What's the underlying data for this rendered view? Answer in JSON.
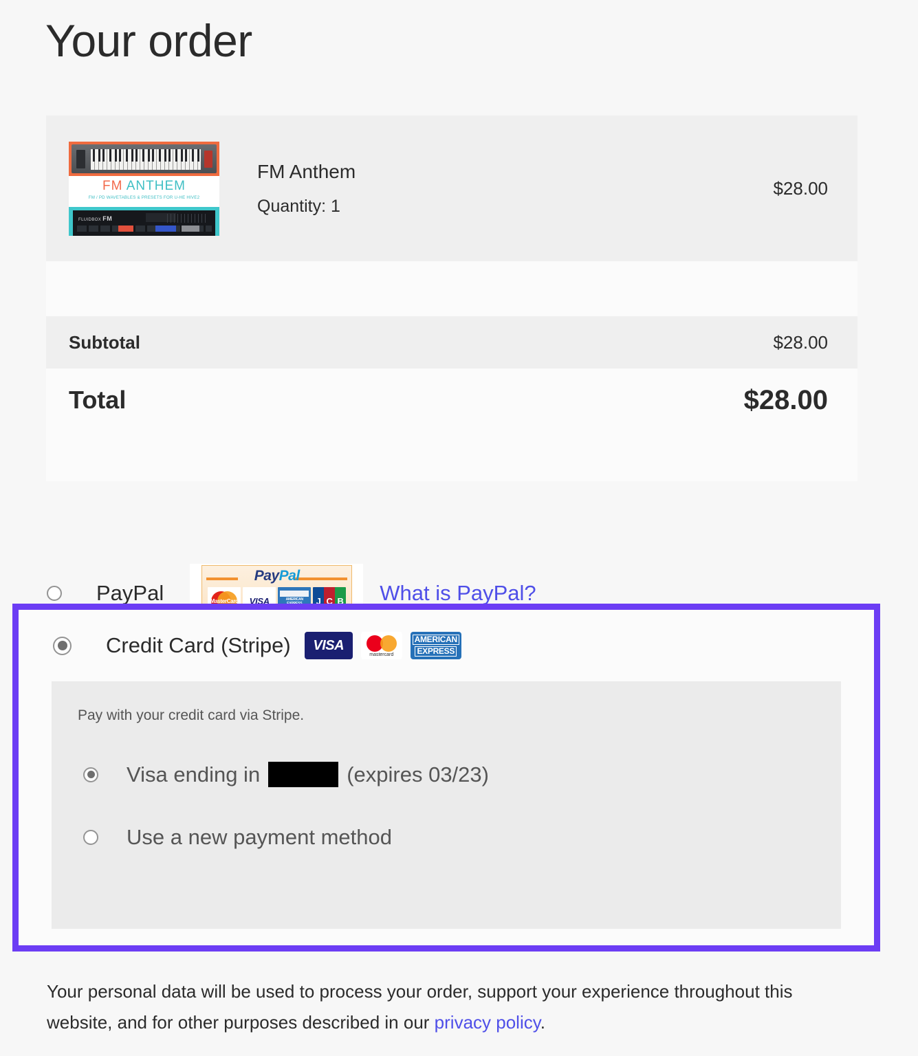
{
  "page": {
    "title": "Your order"
  },
  "order": {
    "product": {
      "name": "FM Anthem",
      "quantity_label": "Quantity: 1",
      "price": "$28.00",
      "thumbnail": {
        "title_part1": "FM ",
        "title_part2": "ANTHEM",
        "subtitle": "FM / PD WAVETABLES & PRESETS FOR U-HE HIVE2",
        "synth_logo_brand": "FLUIDBOX",
        "synth_logo_name": "FM"
      }
    },
    "subtotal_label": "Subtotal",
    "subtotal_value": "$28.00",
    "total_label": "Total",
    "total_value": "$28.00"
  },
  "payment": {
    "paypal": {
      "label": "PayPal",
      "link_label": "What is PayPal?",
      "badge": {
        "wordmark_pay": "Pay",
        "wordmark_pal": "Pal",
        "cards": [
          "MasterCard",
          "VISA",
          "AMERICAN EXPRESS",
          "JCB"
        ],
        "mastercard_text": "MasterCard",
        "visa_text": "VISA",
        "amex_text": "AMERICAN EXPRESS",
        "jcb_j": "J",
        "jcb_c": "C",
        "jcb_b": "B"
      }
    },
    "stripe": {
      "label": "Credit Card (Stripe)",
      "description": "Pay with your credit card via Stripe.",
      "brands": {
        "visa_text": "VISA",
        "mastercard_text": "mastercard",
        "amex_line1": "AMERICAN",
        "amex_line2": "EXPRESS"
      },
      "saved_card": {
        "prefix": "Visa ending in",
        "digits_redacted": "",
        "suffix": "(expires 03/23)"
      },
      "new_method_label": "Use a new payment method"
    },
    "highlight_color": "#6c3df4"
  },
  "privacy": {
    "text_before": "Your personal data will be used to process your order, support your experience throughout this website, and for other purposes described in our ",
    "link_label": "privacy policy",
    "text_after": "."
  }
}
